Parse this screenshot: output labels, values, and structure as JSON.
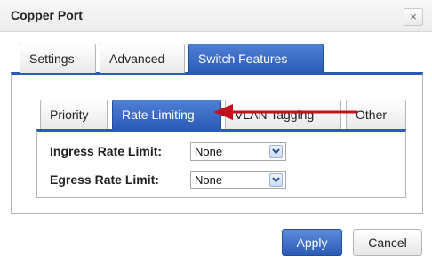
{
  "dialog": {
    "title": "Copper Port",
    "close_label": "×"
  },
  "tabs": {
    "outer": [
      {
        "label": "Settings",
        "active": false
      },
      {
        "label": "Advanced",
        "active": false
      },
      {
        "label": "Switch Features",
        "active": true
      }
    ],
    "inner": [
      {
        "label": "Priority",
        "active": false
      },
      {
        "label": "Rate Limiting",
        "active": true
      },
      {
        "label": "VLAN Tagging",
        "active": false
      },
      {
        "label": "Other",
        "active": false
      }
    ]
  },
  "form": {
    "ingress_label": "Ingress Rate Limit:",
    "ingress_value": "None",
    "egress_label": "Egress Rate Limit:",
    "egress_value": "None"
  },
  "buttons": {
    "apply": "Apply",
    "cancel": "Cancel"
  },
  "colors": {
    "accent": "#2b5ab8",
    "annotation_arrow": "#c0121c"
  },
  "icons": {
    "close": "close-icon",
    "dropdown": "chevron-down-icon",
    "annotation": "red-arrow-icon"
  }
}
